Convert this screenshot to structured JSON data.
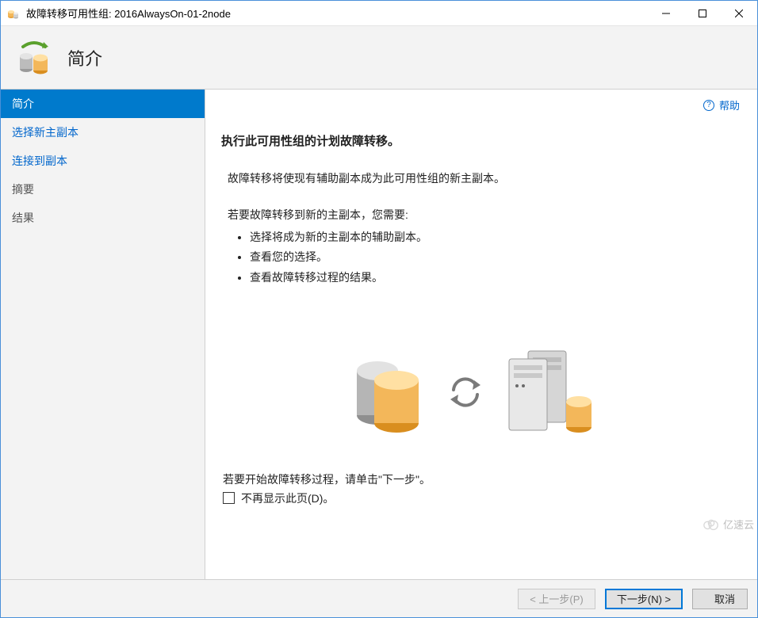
{
  "titlebar": {
    "title": "故障转移可用性组: 2016AlwaysOn-01-2node"
  },
  "header": {
    "page_label": "简介"
  },
  "sidebar": {
    "items": [
      {
        "label": "简介",
        "active": true
      },
      {
        "label": "选择新主副本",
        "active": false
      },
      {
        "label": "连接到副本",
        "active": false
      },
      {
        "label": "摘要",
        "active": false
      },
      {
        "label": "结果",
        "active": false
      }
    ]
  },
  "content": {
    "help_label": "帮助",
    "heading": "执行此可用性组的计划故障转移。",
    "paragraph": "故障转移将使现有辅助副本成为此可用性组的新主副本。",
    "lead": "若要故障转移到新的主副本，您需要:",
    "bullets": [
      "选择将成为新的主副本的辅助副本。",
      "查看您的选择。",
      "查看故障转移过程的结果。"
    ],
    "start_hint": "若要开始故障转移过程，请单击\"下一步\"。",
    "checkbox_label": "不再显示此页(D)。"
  },
  "buttons": {
    "prev": "< 上一步(P)",
    "next": "下一步(N) >",
    "cancel": "取消"
  },
  "watermark": {
    "text": "亿速云"
  }
}
